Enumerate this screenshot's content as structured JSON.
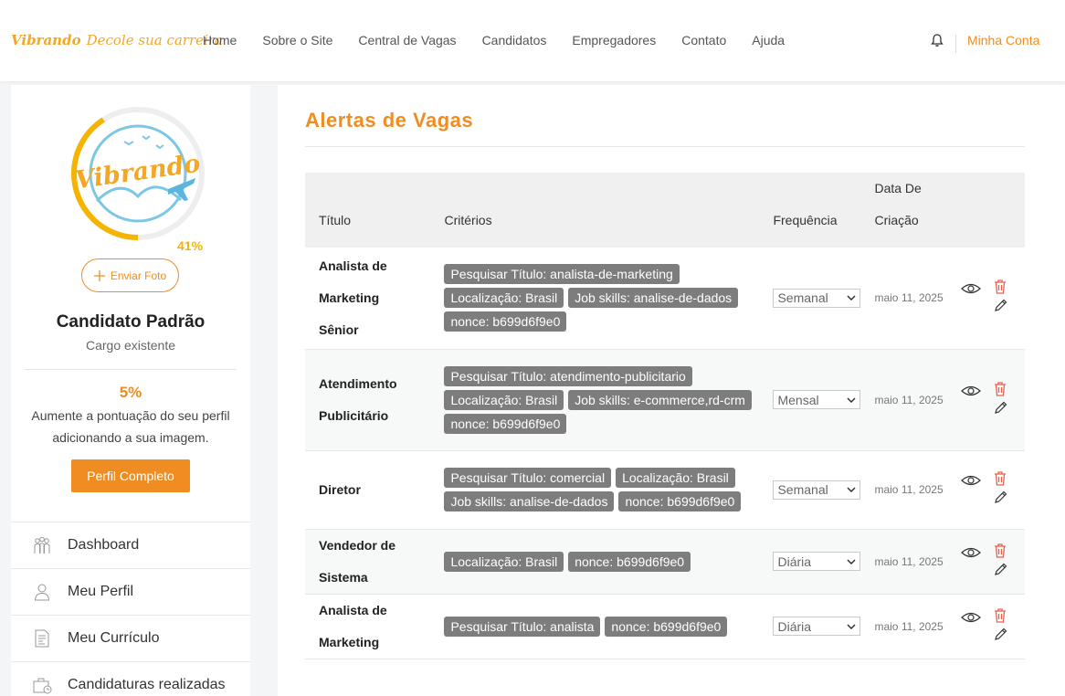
{
  "header": {
    "logo_word": "Vibrando",
    "logo_tagline": "Decole sua carreira",
    "nav": [
      "Home",
      "Sobre o Site",
      "Central de Vagas",
      "Candidatos",
      "Empregadores",
      "Contato",
      "Ajuda"
    ],
    "account_label": "Minha Conta",
    "bell_icon": "bell-icon"
  },
  "sidebar": {
    "avatar_logo": "Vibrando",
    "profile_percent": "41%",
    "upload_label": "Enviar Foto",
    "candidate_name": "Candidato Padrão",
    "candidate_role": "Cargo existente",
    "score": "5%",
    "score_message": "Aumente a pontuação do seu perfil adicionando a sua imagem.",
    "complete_button": "Perfil Completo",
    "menu": [
      {
        "label": "Dashboard",
        "icon": "dashboard-icon"
      },
      {
        "label": "Meu Perfil",
        "icon": "user-icon"
      },
      {
        "label": "Meu Currículo",
        "icon": "document-icon"
      },
      {
        "label": "Candidaturas realizadas",
        "icon": "briefcase-icon"
      }
    ]
  },
  "main": {
    "title": "Alertas de Vagas",
    "columns": {
      "title": "Título",
      "criteria": "Critérios",
      "frequency": "Frequência",
      "date_line1": "Data De",
      "date_line2": "Criação"
    },
    "rows": [
      {
        "title_line1": "Analista de Marketing",
        "title_line2": "Sênior",
        "criteria": [
          "Pesquisar Título: analista-de-marketing",
          "Localização: Brasil",
          "Job skills: analise-de-dados",
          "nonce: b699d6f9e0"
        ],
        "frequency": "Semanal",
        "date": "maio 11, 2025"
      },
      {
        "title_line1": "Atendimento",
        "title_line2": "Publicitário",
        "criteria": [
          "Pesquisar Título: atendimento-publicitario",
          "Localização: Brasil",
          "Job skills: e-commerce,rd-crm",
          "nonce: b699d6f9e0"
        ],
        "frequency": "Mensal",
        "date": "maio 11, 2025"
      },
      {
        "title_line1": "Diretor",
        "title_line2": "",
        "criteria": [
          "Pesquisar Título: comercial",
          "Localização: Brasil",
          "Job skills: analise-de-dados",
          "nonce: b699d6f9e0"
        ],
        "frequency": "Semanal",
        "date": "maio 11, 2025"
      },
      {
        "title_line1": "Vendedor de Sistema",
        "title_line2": "",
        "criteria": [
          "Localização: Brasil",
          "nonce: b699d6f9e0"
        ],
        "frequency": "Diária",
        "date": "maio 11, 2025"
      },
      {
        "title_line1": "Analista de Marketing",
        "title_line2": "",
        "criteria": [
          "Pesquisar Título: analista",
          "nonce: b699d6f9e0"
        ],
        "frequency": "Diária",
        "date": "maio 11, 2025"
      }
    ]
  },
  "colors": {
    "accent": "#f08d22",
    "badge": "#7d7d7d",
    "ring": "#f5b400",
    "delete": "#e8604c"
  }
}
